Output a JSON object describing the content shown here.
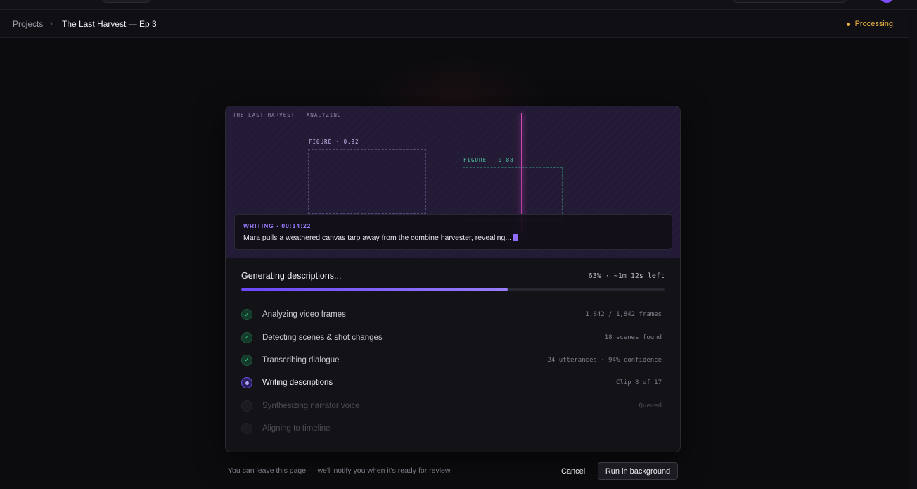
{
  "breadcrumb": {
    "root": "Projects",
    "separator": "›",
    "current": "The Last Harvest — Ep 3"
  },
  "status": {
    "label": "Processing",
    "color": "#f2b640"
  },
  "preview": {
    "overlay_label": "THE LAST HARVEST · ANALYZING",
    "detections": [
      {
        "label": "FIGURE · 0.92",
        "confidence": 0.92
      },
      {
        "label": "FIGURE · 0.88",
        "confidence": 0.88
      }
    ],
    "caption": {
      "meta": "WRITING · 00:14:22",
      "text": "Mara pulls a weathered canvas tarp away from the combine harvester, revealing..."
    }
  },
  "progress": {
    "title": "Generating descriptions...",
    "meta": "63% · ~1m 12s left",
    "percent": 63,
    "accent": "#7c5cff"
  },
  "steps": [
    {
      "label": "Analyzing video frames",
      "meta": "1,842 / 1,842 frames",
      "state": "done",
      "icon": "check-icon"
    },
    {
      "label": "Detecting scenes & shot changes",
      "meta": "18 scenes found",
      "state": "done",
      "icon": "check-icon"
    },
    {
      "label": "Transcribing dialogue",
      "meta": "24 utterances · 94% confidence",
      "state": "done",
      "icon": "check-icon"
    },
    {
      "label": "Writing descriptions",
      "meta": "Clip 8 of 17",
      "state": "active",
      "icon": "active-dot-icon"
    },
    {
      "label": "Synthesizing narrator voice",
      "meta": "Queued",
      "state": "pending",
      "icon": "pending-circle-icon"
    },
    {
      "label": "Aligning to timeline",
      "meta": "",
      "state": "pending",
      "icon": "pending-circle-icon"
    }
  ],
  "footer": {
    "note": "You can leave this page — we'll notify you when it's ready for review.",
    "cancel_label": "Cancel",
    "background_label": "Run in background"
  }
}
